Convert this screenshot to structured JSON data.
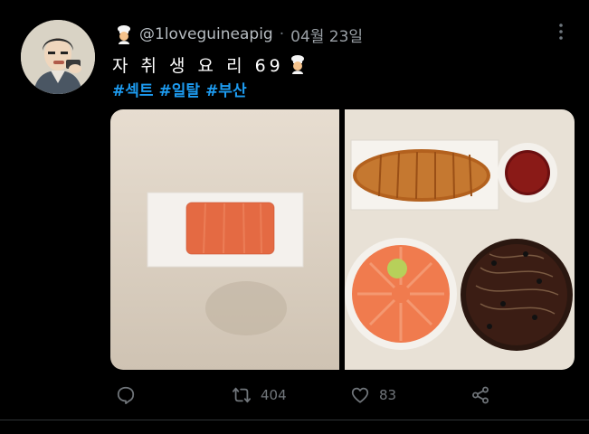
{
  "tweet": {
    "handle": "@1loveguineapig",
    "separator": "·",
    "date": "04월 23일",
    "text": "자 취 생 요 리 69",
    "hashtags": [
      "#섹트",
      "#일탈",
      "#부산"
    ],
    "more_icon": "more-icon"
  },
  "actions": {
    "reply": {
      "icon": "reply-icon",
      "count": ""
    },
    "retweet": {
      "icon": "retweet-icon",
      "count": "404"
    },
    "like": {
      "icon": "heart-icon",
      "count": "83"
    },
    "share": {
      "icon": "share-icon",
      "count": ""
    }
  },
  "colors": {
    "background": "#000000",
    "hashtag": "#1d9bf0",
    "muted": "#71767b"
  }
}
